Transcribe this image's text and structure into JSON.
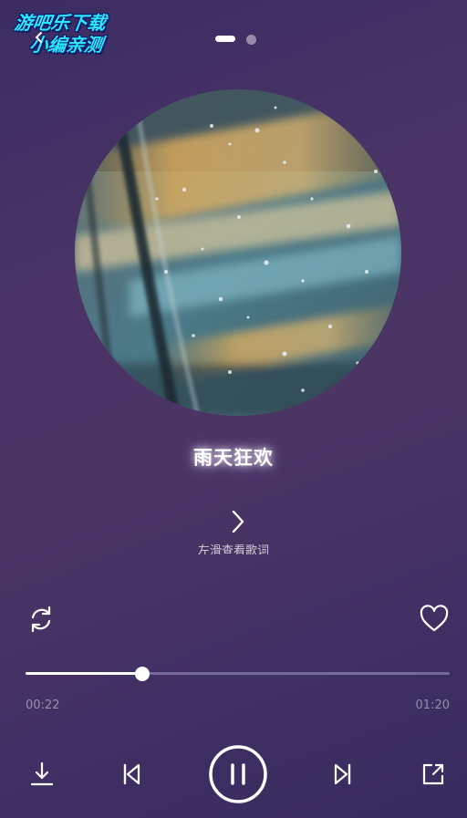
{
  "watermark": {
    "line1": "游吧乐下载",
    "line2": "小编亲测"
  },
  "pager": {
    "active_index": 0,
    "count": 2
  },
  "song": {
    "title": "雨天狂欢",
    "lyrics_hint": "左滑查看歌词"
  },
  "playback": {
    "current_time": "00:22",
    "total_time": "01:20",
    "progress": 0.275
  },
  "icons": {
    "repeat": "repeat-icon",
    "favorite": "heart-icon",
    "download": "download-icon",
    "previous": "skip-previous-icon",
    "play_pause": "pause-icon",
    "next": "skip-next-icon",
    "share": "share-icon",
    "lyrics": "chevron-right-icon"
  },
  "colors": {
    "accent": "#ffffff",
    "watermark": "#2ee6ff"
  }
}
